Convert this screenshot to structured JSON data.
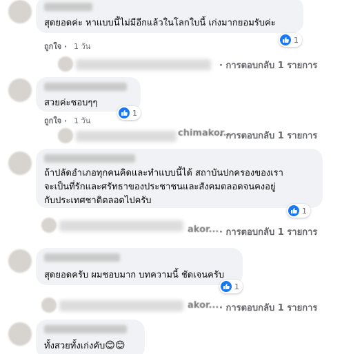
{
  "comments": [
    {
      "text": "สุดยอดค่ะ หาแบบนี้ไม่มีอีกแล้วในโลกใบนี้ เก่งมากยอมรับค่ะ",
      "like_label": "ถูกใจ",
      "time": "1 วัน",
      "reactions": "1",
      "reply_label": "· การตอบกลับ 1 รายการ"
    },
    {
      "text": "สวยค่ะชอบๆๆ",
      "like_label": "ถูกใจ",
      "time": "1 วัน",
      "reactions": "1",
      "reply_name_fragment": "chimakor...",
      "reply_label": "· การตอบกลับ 1 รายการ"
    },
    {
      "text": "ถ้าปลัดอำเภอทุกคนคิดและทำแบบนี้ได้ สถาบันปกครองของเรา\nจะเป็นที่รักและศรัทธาของประชาชนและสังคมตลอดจนคงอยู่\nกับประเทศชาติตลอดไปครับ",
      "reactions": "1",
      "reply_name_fragment": "akor...",
      "reply_label": "· การตอบกลับ 1 รายการ"
    },
    {
      "text": "สุดยอดครับ ผมชอบมาก บทความนี้ ชัดเจนครับ",
      "reactions": "1",
      "reply_name_fragment": "akor...",
      "reply_label": "· การตอบกลับ 1 รายการ"
    },
    {
      "text": "ทั้งสวยทั้งเก่งคับ",
      "emoji": "😊😊"
    }
  ],
  "icons": {
    "reaction": "like-icon"
  },
  "colors": {
    "bubble": "#f0f2f5",
    "like_blue": "#1877f2",
    "meta_gray": "#65676b"
  }
}
